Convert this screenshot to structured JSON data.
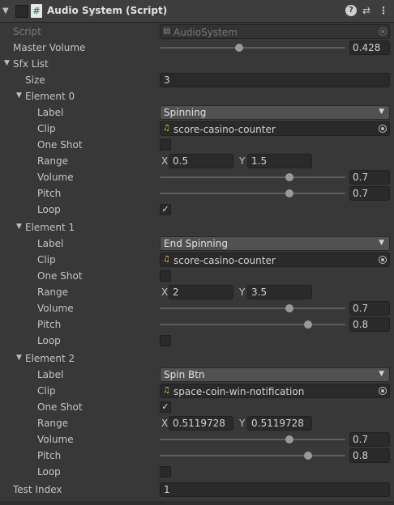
{
  "header": {
    "title": "Audio System (Script)",
    "fold_glyph": "▼",
    "script_glyph": "#",
    "help_glyph": "?",
    "preset_glyph": "⇄",
    "menu_glyph": "⋮"
  },
  "script_field": {
    "label": "Script",
    "value": "AudioSystem"
  },
  "master_volume": {
    "label": "Master Volume",
    "value": "0.428",
    "fraction": 0.428
  },
  "sfx_list": {
    "label": "Sfx List",
    "size_label": "Size",
    "size_value": "3",
    "field_labels": {
      "label": "Label",
      "clip": "Clip",
      "one_shot": "One Shot",
      "range": "Range",
      "volume": "Volume",
      "pitch": "Pitch",
      "loop": "Loop",
      "x": "X",
      "y": "Y"
    },
    "elements": [
      {
        "title": "Element 0",
        "label_value": "Spinning",
        "clip": "score-casino-counter",
        "one_shot": false,
        "range_x": "0.5",
        "range_y": "1.5",
        "volume": "0.7",
        "volume_fraction": 0.7,
        "pitch": "0.7",
        "pitch_fraction": 0.7,
        "loop": true
      },
      {
        "title": "Element 1",
        "label_value": "End Spinning",
        "clip": "score-casino-counter",
        "one_shot": false,
        "range_x": "2",
        "range_y": "3.5",
        "volume": "0.7",
        "volume_fraction": 0.7,
        "pitch": "0.8",
        "pitch_fraction": 0.8,
        "loop": false
      },
      {
        "title": "Element 2",
        "label_value": "Spin Btn",
        "clip": "space-coin-win-notification",
        "one_shot": true,
        "range_x": "0.5119728",
        "range_y": "0.5119728",
        "volume": "0.7",
        "volume_fraction": 0.7,
        "pitch": "0.8",
        "pitch_fraction": 0.8,
        "loop": false
      }
    ]
  },
  "test_index": {
    "label": "Test Index",
    "value": "1"
  },
  "glyphs": {
    "check": "✓",
    "fold_down": "▼",
    "caret_down": "▼",
    "note": "♫",
    "doc": "▤"
  },
  "colors": {
    "background": "#383838",
    "header": "#3e3e3e",
    "field": "#2a2a2a",
    "dropdown": "#515151",
    "text": "#c4c4c4"
  }
}
